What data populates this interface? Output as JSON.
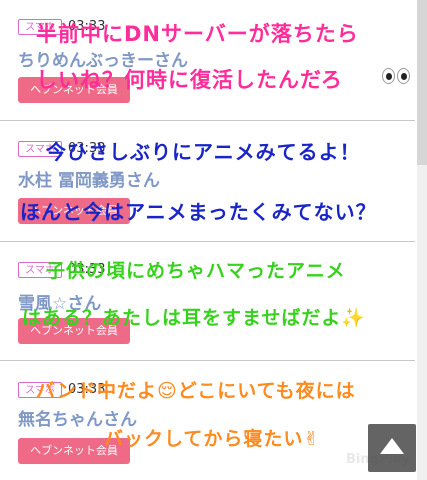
{
  "posts": [
    {
      "badge": "スマホ",
      "time": "03:33",
      "name": "ちりめんぶっきーさん",
      "member_button": "ヘブンネット会員",
      "overlay_lines": [
        "半前中にDNサーバーが落ちたら",
        "しいね？何時に復活したんだろ"
      ],
      "overlay_color": "#ff2d9a",
      "emoji": "eyes-emoji"
    },
    {
      "badge": "スマホ",
      "time": "03:33",
      "name": "水柱 冨岡義勇さん",
      "member_button": "ヘブンネット会員",
      "overlay_lines": [
        "今ひさしぶりにアニメみてるよ！",
        "ほんと今はアニメまったくみてない？"
      ],
      "overlay_color": "#1a25c7"
    },
    {
      "badge": "スマホ",
      "time": "03:33",
      "name": "雪風☆さん",
      "member_button": "ヘブンネット会員",
      "overlay_lines": [
        "子供の頃にめちゃハマったアニメ",
        "はある？あたしは耳をすませばだよ✨"
      ],
      "overlay_color": "#38d21e"
    },
    {
      "badge": "スマホ",
      "time": "03:33",
      "name": "無名ちゃんさん",
      "member_button": "ヘブンネット会員",
      "overlay_lines": [
        "バンド中だよ😌どこにいても夜には",
        "バックしてから寝たい✌"
      ],
      "overlay_color": "#ff8a1e"
    }
  ],
  "watermark": "BingPlay",
  "scroll_top_icon": "arrow-up-icon"
}
